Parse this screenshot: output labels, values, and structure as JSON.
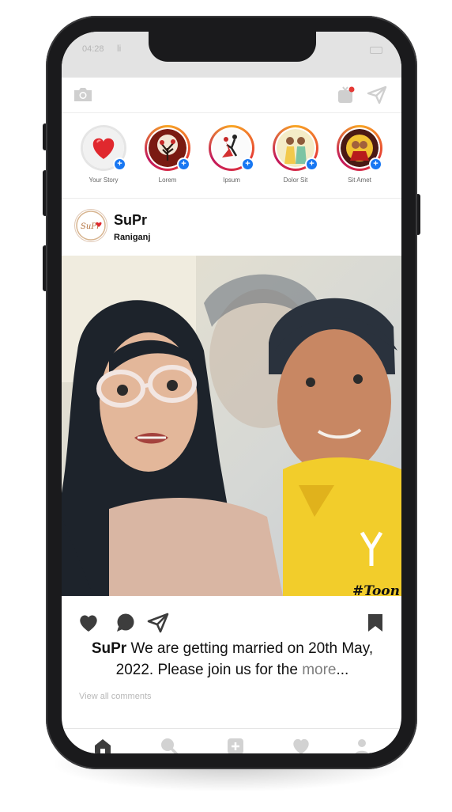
{
  "status_bar": {
    "time": "04:28",
    "carrier": "li"
  },
  "stories": [
    {
      "label": "Your Story",
      "own": true
    },
    {
      "label": "Lorem"
    },
    {
      "label": "Ipsum"
    },
    {
      "label": "Dolor Sit"
    },
    {
      "label": "Sit Amet"
    }
  ],
  "post": {
    "username": "SuPr",
    "location": "Raniganj",
    "avatar_text": "SuPr",
    "watermark": "#Toon",
    "caption": {
      "username": "SuPr",
      "text": " We are getting married on 20th May, 2022. Please join us for the ",
      "more": "more",
      "ellipsis": "..."
    },
    "view_comments": "View all comments"
  },
  "colors": {
    "accent": "#1877f2",
    "heart": "#e0282e",
    "icon": "#3d3d3d"
  },
  "icons": {
    "top_left": "camera-icon",
    "top_right": [
      "igtv-icon",
      "send-icon"
    ],
    "actions": [
      "heart-icon",
      "comment-icon",
      "share-icon",
      "bookmark-icon"
    ],
    "bottom_nav": [
      "home-icon",
      "search-icon",
      "add-icon",
      "heart-icon",
      "profile-icon"
    ]
  }
}
